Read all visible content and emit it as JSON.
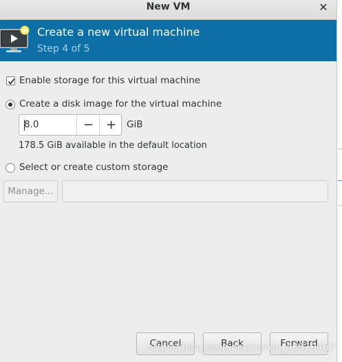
{
  "window": {
    "title": "New VM"
  },
  "banner": {
    "title": "Create a new virtual machine",
    "step": "Step 4 of 5",
    "color": "#0e6ea6"
  },
  "storage": {
    "enable_label": "Enable storage for this virtual machine",
    "enable_checked": true,
    "disk_image_label": "Create a disk image for the virtual machine",
    "disk_image_selected": true,
    "size_value": "8.0",
    "size_unit": "GiB",
    "available_text": "178.5 GiB available in the default location",
    "custom_label": "Select or create custom storage",
    "custom_selected": false,
    "manage_label": "Manage...",
    "custom_path_value": ""
  },
  "footer": {
    "cancel_label": "Cancel",
    "back_label": "Back",
    "forward_label": "Forward"
  },
  "watermark": "https://blog.csdn.net/weixin_43819467"
}
